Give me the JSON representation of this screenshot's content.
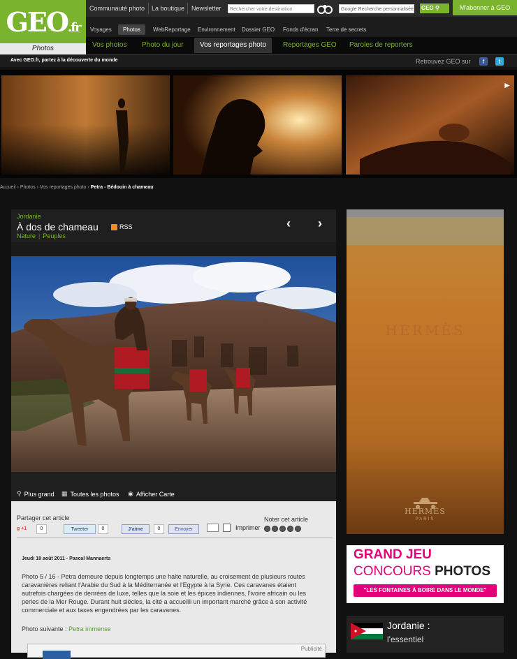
{
  "header": {
    "logo": "GEO",
    "logo_suffix": ".fr",
    "section_tab": "Photos",
    "top_links": [
      "Communauté photo",
      "La boutique",
      "Newsletter"
    ],
    "search_placeholder": "Rechercher votre destination",
    "google_search": "Recherche personnalisée",
    "geo_search": "GEO",
    "subscribe": "M'abonner à GEO",
    "nav": [
      "Voyages",
      "Photos",
      "WebReportage",
      "Environnement",
      "Dossier GEO",
      "Fonds d'écran",
      "Terre de secrets"
    ],
    "nav_active": "Photos",
    "subnav": [
      "Vos photos",
      "Photo du jour",
      "Vos reportages photo",
      "Reportages GEO",
      "Paroles de reporters"
    ],
    "subnav_active": "Vos reportages photo",
    "tagline": "Avec GEO.fr, partez à la découverte du monde",
    "retrouvez": "Retrouvez GEO sur",
    "social": [
      "facebook-icon",
      "twitter-icon"
    ]
  },
  "breadcrumb": {
    "items": [
      "Accueil",
      "Photos",
      "Vos reportages photo"
    ],
    "current": "Petra - Bédouin à chameau"
  },
  "article": {
    "country": "Jordanie",
    "title": "À dos de chameau",
    "rss": "RSS",
    "categories": [
      "Nature",
      "Peuples"
    ],
    "photo_actions": [
      "Plus grand",
      "Toutes les photos",
      "Afficher Carte"
    ]
  },
  "share": {
    "label": "Partager cet article",
    "gplus": "+1",
    "gplus_count": "0",
    "tweet": "Tweeter",
    "tweet_count": "0",
    "fb_like": "J'aime",
    "fb_count": "0",
    "envoyer": "Envoyer",
    "imprimer": "Imprimer",
    "noter": "Noter cet article",
    "stars": 5
  },
  "content": {
    "meta": "Jeudi 18 août 2011 - Pascal Mannaerts",
    "body": "Photo 5 / 16 - Petra demeure depuis longtemps une halte naturelle, au croisement de plusieurs routes caravanières reliant l'Arabie du Sud à la Méditerranée et l'Egypte à la Syrie. Ces caravanes étaient autrefois chargées de denrées de luxe, telles que la soie et les épices indiennes, l'ivoire africain ou les perles de la Mer Rouge. Durant huit siècles, la cité a accueilli un important marché grâce à son activité commerciale et aux taxes engendrées par les caravanes.",
    "next_label": "Photo suivante :",
    "next_link": "Petra immense",
    "pub_label": "Publicité"
  },
  "ads": {
    "hermes_ghost": "HERMÈS",
    "hermes": "HERMÈS",
    "hermes_sub": "PARIS",
    "jeu_l1": "GRAND JEU",
    "jeu_l2a": "CONCOURS ",
    "jeu_l2b": "PHOTOS",
    "jeu_l3": "\"LES FONTAINES À BOIRE DANS LE MONDE\""
  },
  "jordan_box": {
    "title": "Jordanie :",
    "subtitle": "l'essentiel"
  },
  "colors": {
    "brand_green": "#7ab32e",
    "ad_pink": "#e3007b"
  }
}
